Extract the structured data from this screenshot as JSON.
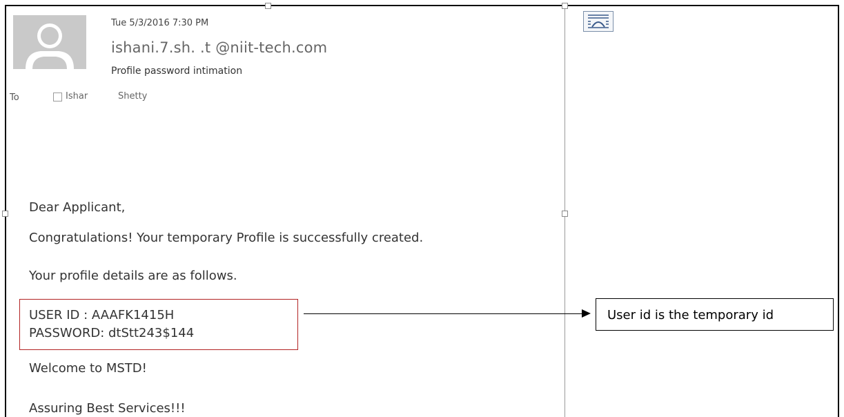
{
  "email": {
    "date_time": "Tue 5/3/2016 7:30 PM",
    "sender": "ishani.7.sh. .t @niit-tech.com",
    "subject": "Profile password intimation",
    "to_label": "To",
    "to_name": "Ishar",
    "to_surname": "Shetty"
  },
  "body": {
    "greeting": "Dear Applicant,",
    "line1": "Congratulations! Your temporary Profile is successfully created.",
    "line2": "Your profile details are as follows.",
    "user_id": "USER ID : AAAFK1415H",
    "password": "PASSWORD: dtStt243$144",
    "welcome": "Welcome to MSTD!",
    "closing": "Assuring Best Services!!!"
  },
  "annotation": {
    "callout_text": "User id is the temporary id",
    "highlight_color": "#b22222"
  },
  "icons": {
    "avatar": "default-avatar-icon",
    "layout": "text-wrap-layout-icon"
  }
}
